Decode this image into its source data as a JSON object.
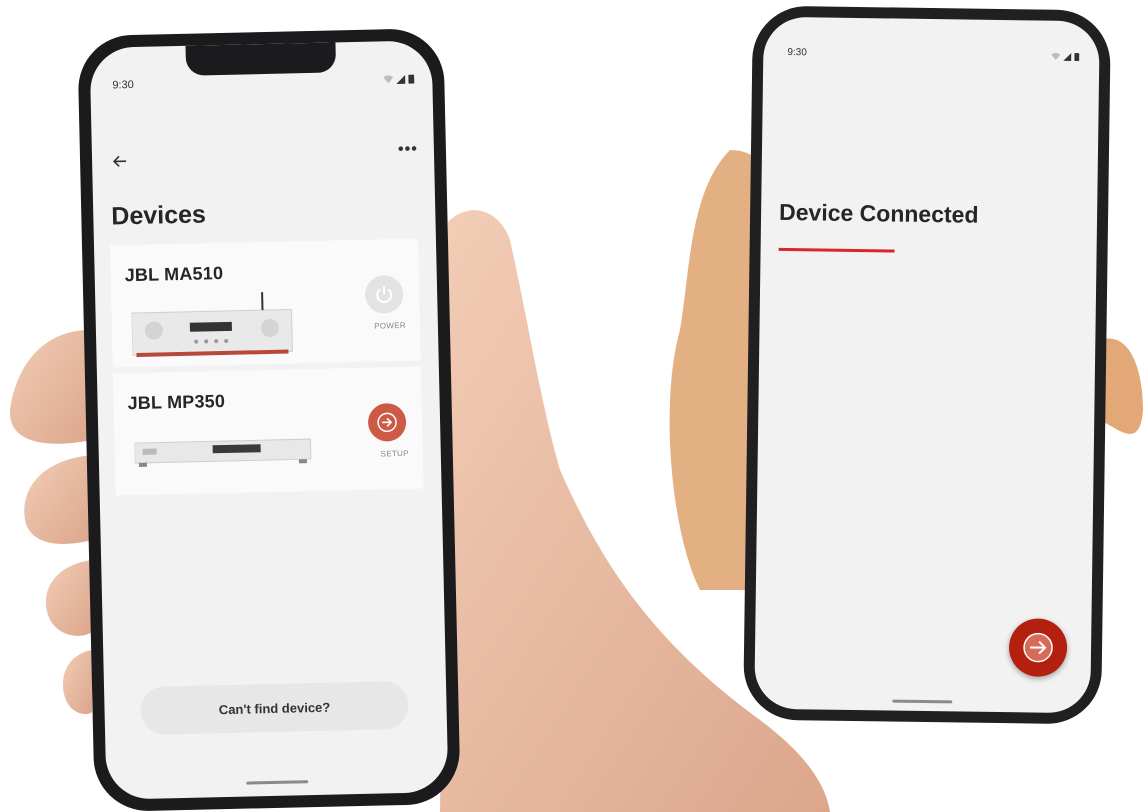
{
  "left_phone": {
    "status_time": "9:30",
    "page_title": "Devices",
    "devices": [
      {
        "name": "JBL  MA510",
        "action_label": "POWER",
        "action_icon": "power-icon"
      },
      {
        "name": "JBL MP350",
        "action_label": "SETUP",
        "action_icon": "arrow-right-icon"
      }
    ],
    "cant_find_label": "Can't find device?"
  },
  "right_phone": {
    "status_time": "9:30",
    "title": "Device Connected",
    "next_icon": "arrow-right-icon"
  },
  "colors": {
    "accent_red": "#d9262c",
    "setup_button": "#cc5a44",
    "fab": "#b3200f",
    "screen_bg": "#f2f2f2"
  }
}
